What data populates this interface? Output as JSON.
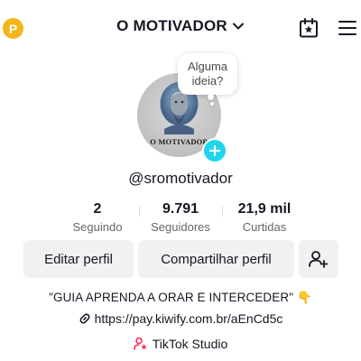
{
  "header": {
    "coin_letter": "P",
    "account_name": "O MOTIVADOR"
  },
  "avatar": {
    "brand_text": "O MOTIVADOR"
  },
  "bubble": {
    "text_line1": "Alguma",
    "text_line2": "ideia?"
  },
  "profile": {
    "username": "@sromotivador"
  },
  "stats": [
    {
      "value": "2",
      "label": "Seguindo"
    },
    {
      "value": "9.791",
      "label": "Seguidores"
    },
    {
      "value": "21,9 mil",
      "label": "Curtidas"
    }
  ],
  "buttons": {
    "edit": "Editar perfil",
    "share": "Compartilhar perfil"
  },
  "bio": {
    "text": "\"GUIA APRENDA A ORAR E INTERCEDER\" 👇",
    "link": "https://pay.kiwify.com.br/aEnCd5c"
  },
  "studio": {
    "label": "TikTok Studio"
  },
  "colors": {
    "accent_cyan": "#20d5ec",
    "coin_gold": "#f5b418",
    "studio_pink": "#fe2c55",
    "button_bg": "#f1f1f2"
  }
}
